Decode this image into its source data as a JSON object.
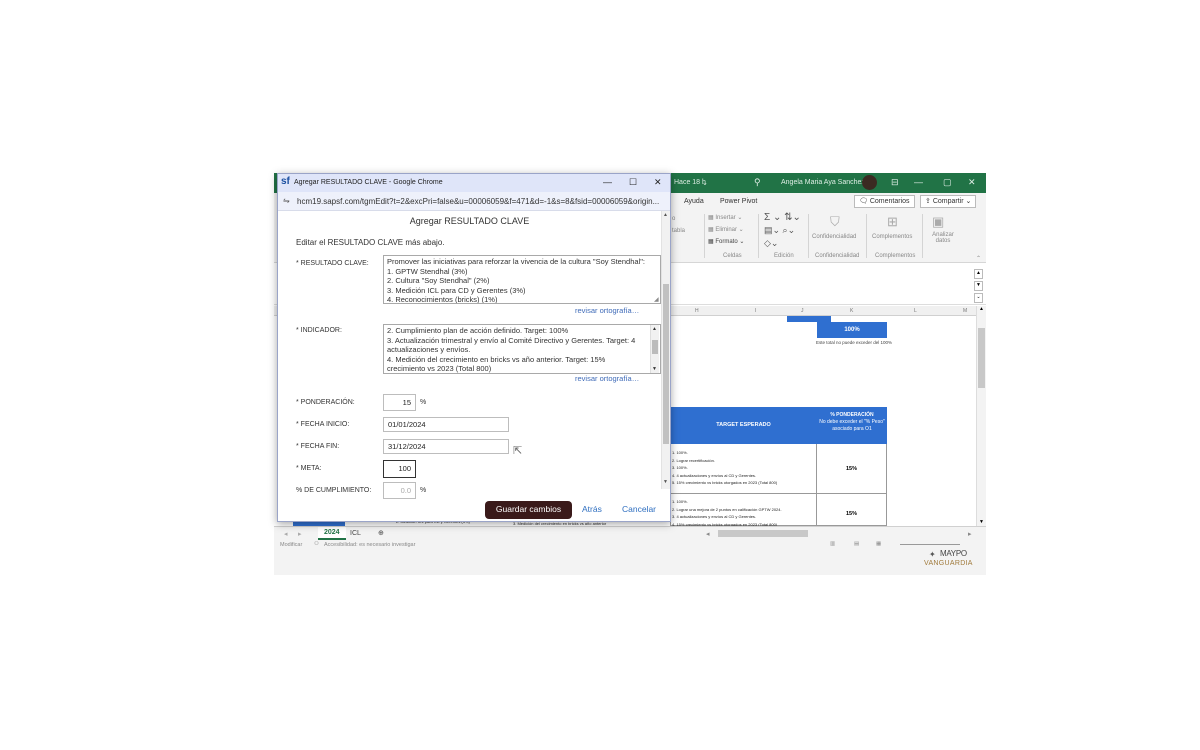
{
  "excel": {
    "titlebar": {
      "saved_status": "Hace 18 h",
      "user_name": "Angela Maria Aya Sanchez",
      "buttons": [
        "—",
        "▢",
        "✕"
      ]
    },
    "menu": {
      "items": [
        "Ayuda",
        "Power Pivot"
      ],
      "comments_label": "Comentarios",
      "share_label": "Compartir"
    },
    "ribbon": {
      "insert": "Insertar",
      "delete": "Eliminar",
      "format": "Formato",
      "cells_group": "Celdas",
      "editing_group": "Edición",
      "confidentiality": "Confidencialidad",
      "confidentiality_group": "Confidencialidad",
      "complements": "Complementos",
      "complements_group": "Complementos",
      "analyze_data": "Analizar datos",
      "tabla_fragment": "tabla",
      "formato_fragment": "o"
    },
    "columns": [
      "H",
      "I",
      "J",
      "K",
      "L",
      "M"
    ],
    "cells": {
      "percent_100": "100%",
      "total_note": "Este total no puede exceder del 100%",
      "target_header": "TARGET ESPERADO",
      "ponderacion_header": "% PONDERACIÓN",
      "ponderacion_sub1": "No debe exceder el \"% Peso\"",
      "ponderacion_sub2": "asociado para O1",
      "row1_lines": [
        "1. 100%.",
        "2. Lograr recertificación.",
        "3. 100%.",
        "4. 4 actualizaciones y envíos al CD y Gerentes.",
        "5. 15% crecimiento vs bricks otorgados en 2023 (Total 800)"
      ],
      "row1_value": "15%",
      "row2_lines": [
        "1. 100%.",
        "2. Lograr una mejora de 2 puntos en calificación GPTW 2024.",
        "3. 4 actualizaciones y envíos al CD y Gerentes.",
        "4. 15% crecimiento vs bricks otorgados en 2023 (Total 800)"
      ],
      "row2_value": "15%",
      "bottom_left_cell": "2. Medición ICL para CD y Gerentes (3%)",
      "bottom_mid_cell": "3. Medición del crecimiento en bricks vs año anterior"
    },
    "sheet_tabs": [
      "2024",
      "ICL"
    ],
    "status": {
      "mode": "Modificar",
      "accessibility": "Accesibilidad: es necesario investigar"
    },
    "watermark": {
      "brand": "MAYPO",
      "sub": "VANGUARDIA"
    }
  },
  "popup": {
    "window_title": "Agregar RESULTADO CLAVE - Google Chrome",
    "window_buttons": [
      "—",
      "☐",
      "✕"
    ],
    "url": "hcm19.sapsf.com/tgmEdit?t=2&excPri=false&u=00006059&f=471&d=-1&s=8&fsid=00006059&origin...",
    "heading": "Agregar RESULTADO CLAVE",
    "instructions": "Editar el RESULTADO CLAVE más abajo.",
    "fields": {
      "resultado_label": "* RESULTADO CLAVE:",
      "resultado_lines": [
        "Promover las iniciativas para reforzar la vivencia de la cultura \"Soy Stendhal\":",
        "1. GPTW Stendhal (3%)",
        "2. Cultura \"Soy Stendhal\" (2%)",
        "3. Medición ICL para CD y Gerentes (3%)",
        "4. Reconocimientos (bricks) (1%)"
      ],
      "spellcheck_1": "revisar ortografía…",
      "indicador_label": "* INDICADOR:",
      "indicador_lines": [
        "2. Cumplimiento plan de acción definido. Target: 100%",
        "3. Actualización trimestral y envío al Comité Directivo y Gerentes. Target: 4",
        "actualizaciones y envíos.",
        "4. Medición del crecimiento en bricks vs año anterior. Target: 15%",
        "crecimiento vs 2023 (Total 800)"
      ],
      "spellcheck_2": "revisar ortografía…",
      "ponderacion_label": "* PONDERACIÓN:",
      "ponderacion_value": "15",
      "percent_sign": "%",
      "fecha_inicio_label": "* FECHA INICIO:",
      "fecha_inicio_value": "01/01/2024",
      "fecha_fin_label": "* FECHA FIN:",
      "fecha_fin_value": "31/12/2024",
      "meta_label": "* META:",
      "meta_value": "100",
      "cumplimiento_label": "% DE CUMPLIMIENTO:",
      "cumplimiento_value": "0.0"
    },
    "buttons": {
      "save": "Guardar cambios",
      "back": "Atrás",
      "cancel": "Cancelar"
    }
  },
  "colors": {
    "excel_green": "#217346",
    "header_blue": "#2f6fd0",
    "save_button": "#3a1a1a",
    "link_blue": "#2f6fc0"
  }
}
